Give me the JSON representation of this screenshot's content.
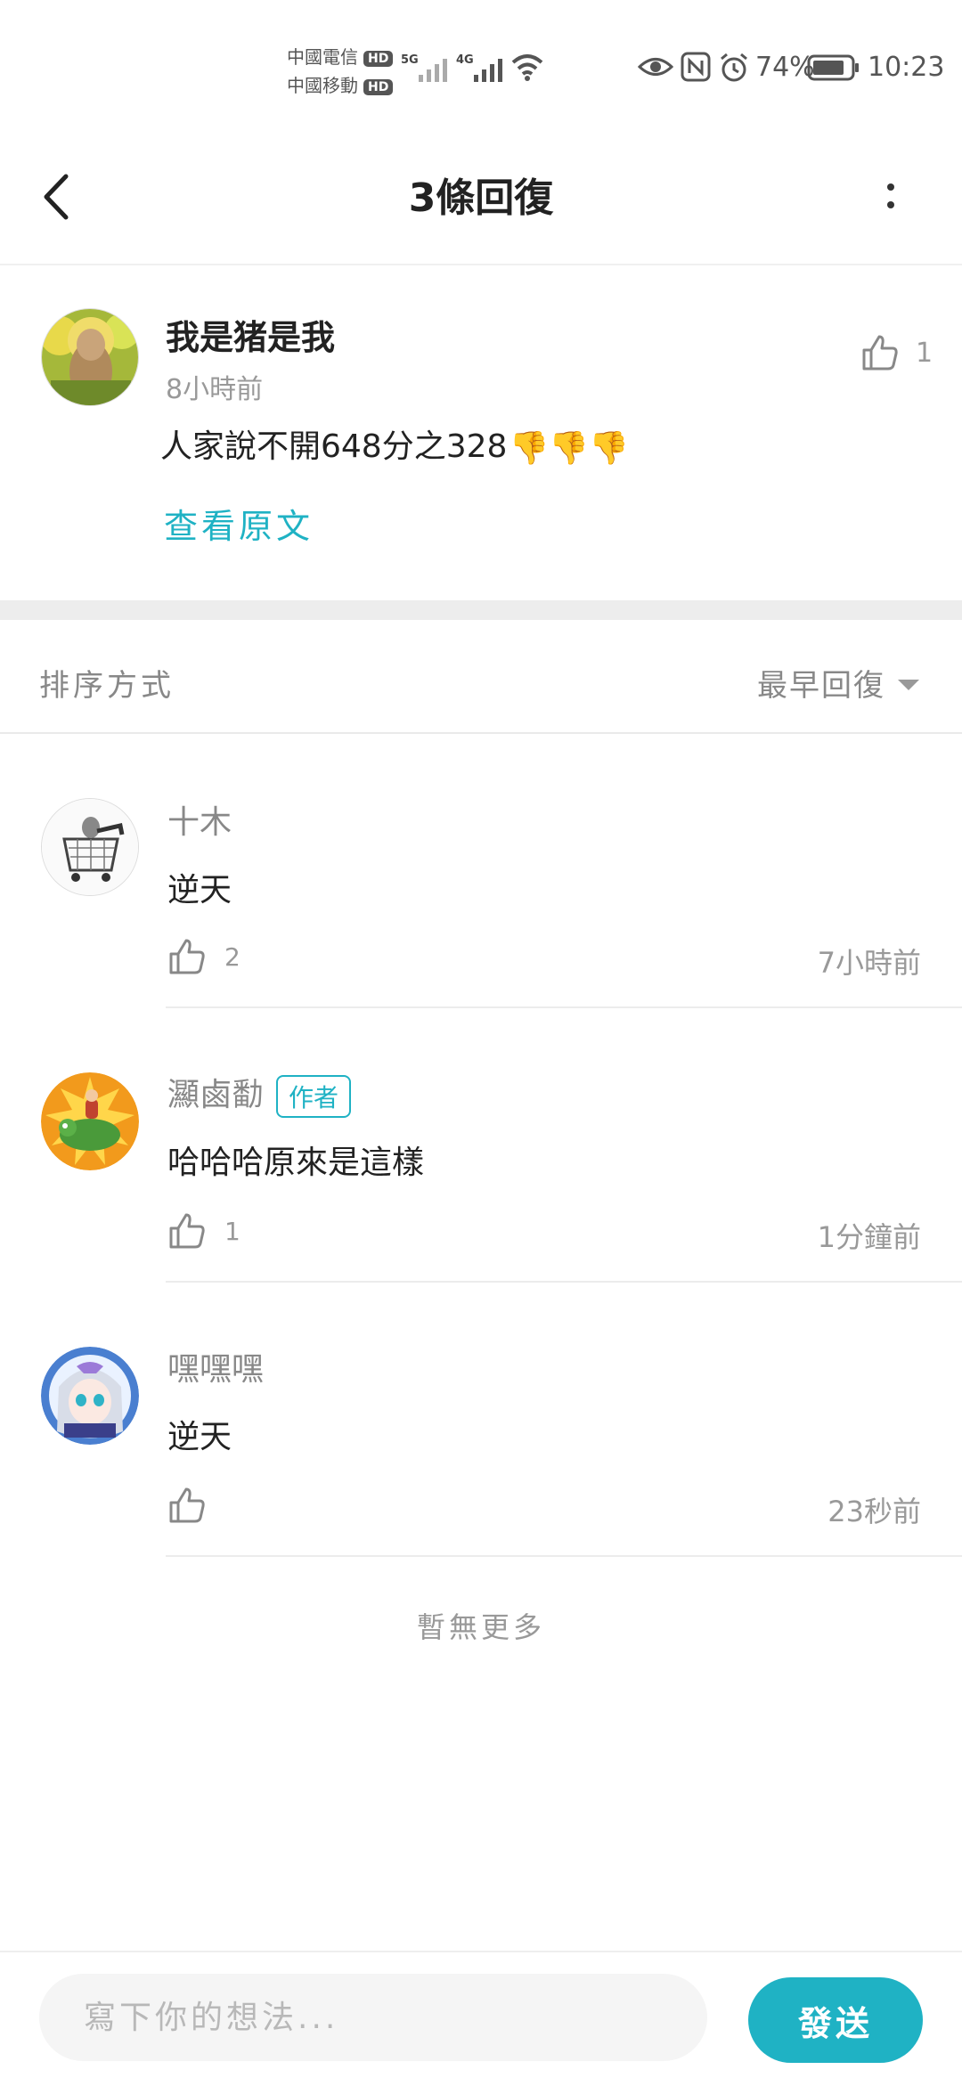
{
  "status_bar": {
    "carrier1": "中國電信",
    "carrier2": "中國移動",
    "hd": "HD",
    "net1": "5G",
    "net2": "4G",
    "battery": "74%",
    "time": "10:23"
  },
  "header": {
    "title": "3條回復"
  },
  "post": {
    "username": "我是猪是我",
    "time": "8小時前",
    "text": "人家說不開648分之328",
    "emoji": "👎👎👎",
    "view_original": "查看原文",
    "like_count": "1"
  },
  "sort": {
    "label": "排序方式",
    "value": "最早回復"
  },
  "replies": [
    {
      "name": "十木",
      "text": "逆天",
      "likes": "2",
      "time": "7小時前",
      "is_author": false
    },
    {
      "name": "灦鹵勫",
      "text": "哈哈哈原來是這樣",
      "likes": "1",
      "time": "1分鐘前",
      "is_author": true
    },
    {
      "name": "嘿嘿嘿",
      "text": "逆天",
      "likes": "",
      "time": "23秒前",
      "is_author": false
    }
  ],
  "author_badge": "作者",
  "no_more": "暫無更多",
  "composer": {
    "placeholder": "寫下你的想法...",
    "send_label": "發送"
  },
  "colors": {
    "accent": "#1fb2c4",
    "separator": "#ededed"
  }
}
